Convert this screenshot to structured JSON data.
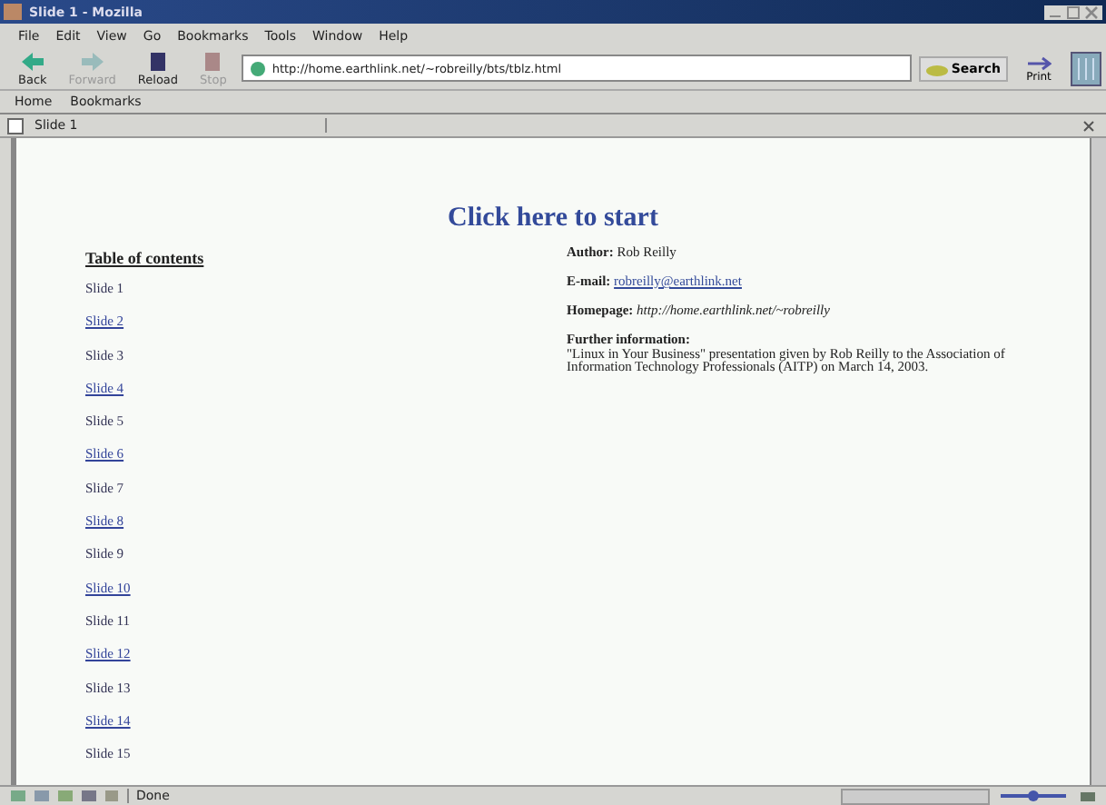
{
  "window": {
    "title": "Slide 1 - Mozilla"
  },
  "menu": [
    "File",
    "Edit",
    "View",
    "Go",
    "Bookmarks",
    "Tools",
    "Window",
    "Help"
  ],
  "toolbar": [
    {
      "label": "Back",
      "kind": "back",
      "disabled": false
    },
    {
      "label": "Forward",
      "kind": "forward",
      "disabled": true
    },
    {
      "label": "Reload",
      "kind": "reload",
      "disabled": false
    },
    {
      "label": "Stop",
      "kind": "stop",
      "disabled": true
    }
  ],
  "address": {
    "value": "http://home.earthlink.net/~robreilly/bts/tblz.html"
  },
  "search_button": "Search",
  "print_button": "Print",
  "bookmarks_bar": [
    "Home",
    "Bookmarks"
  ],
  "tab": {
    "label": "Slide 1"
  },
  "page": {
    "heading": "Click here to start",
    "toc_title": "Table of contents",
    "slides": [
      {
        "label": "Slide 1",
        "kind": "text"
      },
      {
        "label": "Slide 2",
        "kind": "link"
      },
      {
        "label": "Slide 3",
        "kind": "text"
      },
      {
        "label": "Slide 4",
        "kind": "link"
      },
      {
        "label": "Slide 5",
        "kind": "text"
      },
      {
        "label": "Slide 6",
        "kind": "link"
      },
      {
        "label": "Slide 7",
        "kind": "text"
      },
      {
        "label": "Slide 8",
        "kind": "link"
      },
      {
        "label": "Slide 9",
        "kind": "text"
      },
      {
        "label": "Slide 10",
        "kind": "link"
      },
      {
        "label": "Slide 11",
        "kind": "text"
      },
      {
        "label": "Slide 12",
        "kind": "link"
      },
      {
        "label": "Slide 13",
        "kind": "text"
      },
      {
        "label": "Slide 14",
        "kind": "link"
      },
      {
        "label": "Slide 15",
        "kind": "text"
      }
    ],
    "info": [
      {
        "label": "Author:",
        "value": "Rob Reilly",
        "kind": "text"
      },
      {
        "label": "E-mail:",
        "value": "robreilly@earthlink.net",
        "kind": "link"
      },
      {
        "label": "Homepage:",
        "value": "http://home.earthlink.net/~robreilly",
        "kind": "italic"
      },
      {
        "label": "Further information:",
        "value": "\"Linux in Your Business\" presentation given by Rob Reilly to the Association of Information Technology Professionals (AITP) on March 14, 2003.",
        "kind": "block"
      }
    ]
  },
  "status_bar": {
    "text": "Done"
  }
}
